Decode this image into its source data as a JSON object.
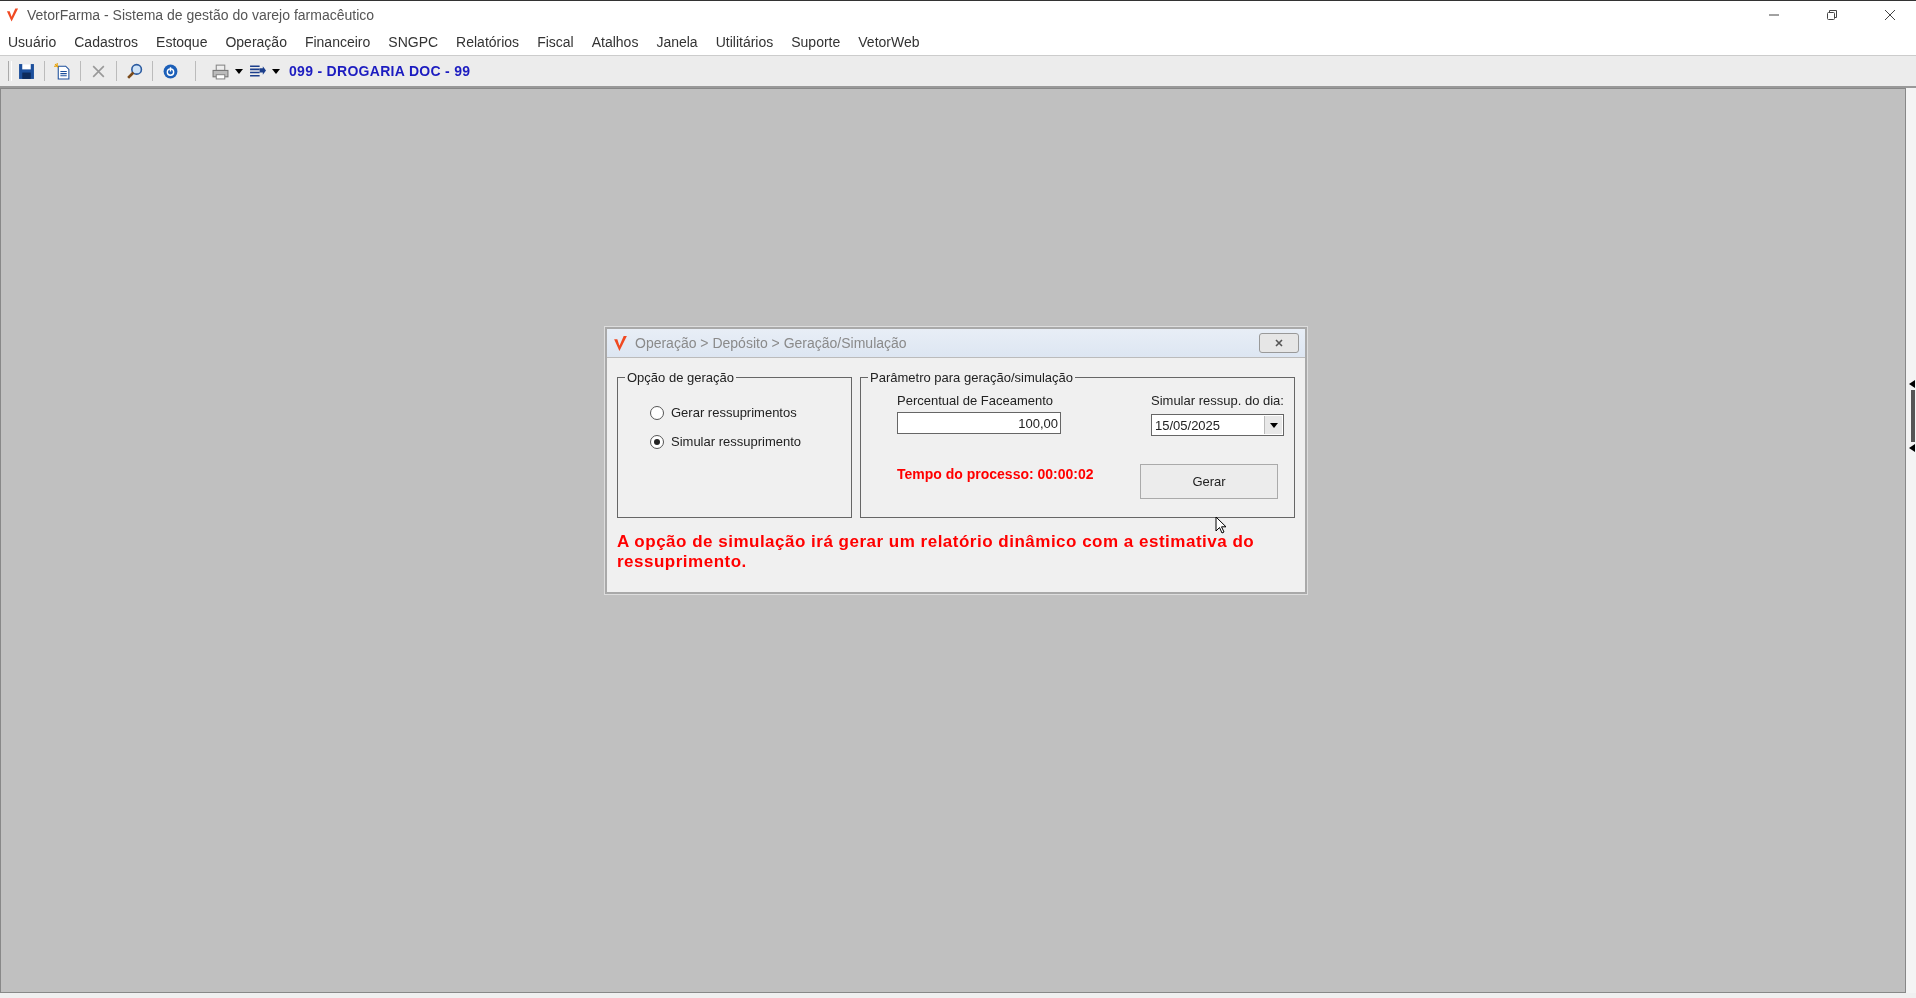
{
  "window": {
    "title": "VetorFarma - Sistema de gestão do varejo farmacêutico"
  },
  "menu": [
    "Usuário",
    "Cadastros",
    "Estoque",
    "Operação",
    "Financeiro",
    "SNGPC",
    "Relatórios",
    "Fiscal",
    "Atalhos",
    "Janela",
    "Utilitários",
    "Suporte",
    "VetorWeb"
  ],
  "toolbar": {
    "company": "099 - DROGARIA DOC - 99"
  },
  "dialog": {
    "title": "Operação > Depósito > Geração/Simulação",
    "options_group": {
      "title": "Opção de geração",
      "options": [
        {
          "label": "Gerar ressuprimentos",
          "selected": false
        },
        {
          "label": "Simular ressuprimento",
          "selected": true
        }
      ]
    },
    "params_group": {
      "title": "Parâmetro para geração/simulação",
      "percent_label": "Percentual de Faceamento",
      "percent_value": "100,00",
      "date_label": "Simular ressup. do dia:",
      "date_value": "15/05/2025",
      "process_time": "Tempo do processo: 00:00:02",
      "button": "Gerar"
    },
    "note": "A opção de simulação irá gerar um relatório dinâmico com a estimativa do ressuprimento."
  }
}
